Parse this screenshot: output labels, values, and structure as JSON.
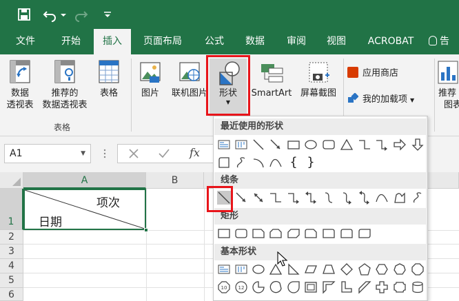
{
  "tabs": [
    "文件",
    "开始",
    "插入",
    "页面布局",
    "公式",
    "数据",
    "审阅",
    "视图",
    "ACROBAT"
  ],
  "active_tab": "插入",
  "tell_me_partial": "告",
  "ribbon": {
    "pivot_label_1": "数据",
    "pivot_label_2": "透视表",
    "recommended_pivot_1": "推荐的",
    "recommended_pivot_2": "数据透视表",
    "table_label": "表格",
    "tables_group": "表格",
    "picture_label": "图片",
    "online_picture_label": "联机图片",
    "shapes_label": "形状",
    "smartart_label": "SmartArt",
    "screenshot_label": "屏幕截图",
    "app_store_label": "应用商店",
    "my_addins_label": "我的加载项",
    "recommended_charts_1": "推荐",
    "recommended_charts_2": "图表"
  },
  "formula_bar": {
    "name_box": "A1",
    "fx": "fx"
  },
  "sheet": {
    "col_a": "A",
    "col_b": "B",
    "rows": [
      "1",
      "2",
      "3",
      "4",
      "5",
      "6"
    ],
    "cell_a1_top": "项次",
    "cell_a1_bottom": "日期"
  },
  "shapes_panel": {
    "recent": "最近使用的形状",
    "lines": "线条",
    "rectangles": "矩形",
    "basic": "基本形状",
    "badge_10": "10",
    "badge_12": "12"
  },
  "colors": {
    "accent": "#217346",
    "highlight": "#e8141a"
  }
}
